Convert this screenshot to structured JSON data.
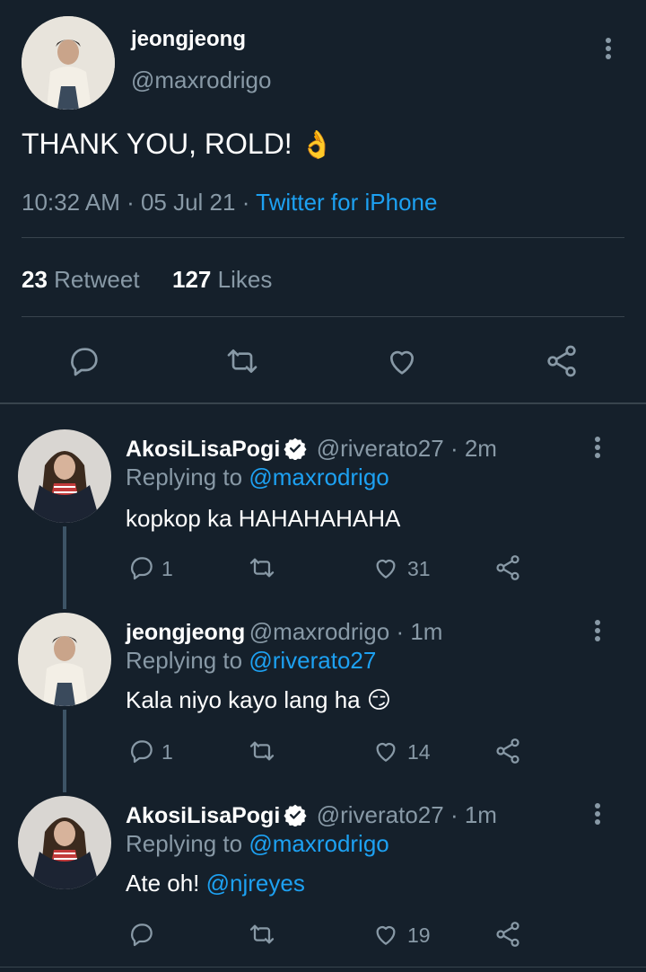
{
  "main_tweet": {
    "name": "jeongjeong",
    "handle": "@maxrodrigo",
    "text": "THANK YOU, ROLD!",
    "emoji": "👌",
    "time": "10:32 AM · 05 Jul 21 ·",
    "source": "Twitter for iPhone",
    "retweet_count": "23",
    "retweet_label": "Retweet",
    "likes_count": "127",
    "likes_label": "Likes"
  },
  "replies": [
    {
      "name": "AkosiLisaPogi",
      "handle": "@riverato27 · 2m",
      "replying_label": "Replying to",
      "replying_to": "@maxrodrigo",
      "text": "kopkop ka HAHAHAHAHA",
      "reply_count": "1",
      "like_count": "31"
    },
    {
      "name": "jeongjeong",
      "handle": "@maxrodrigo · 1m",
      "replying_label": "Replying to",
      "replying_to": "@riverato27",
      "text": "Kala niyo kayo lang ha",
      "emoji": "😏",
      "reply_count": "1",
      "like_count": "14"
    },
    {
      "name": "AkosiLisaPogi",
      "handle": "@riverato27 · 1m",
      "replying_label": "Replying to",
      "replying_to": "@maxrodrigo",
      "text": "Ate oh!",
      "mention": "@njreyes",
      "reply_count": "",
      "like_count": "19"
    }
  ],
  "colors": {
    "background": "#15202b",
    "muted": "#8899a6",
    "link": "#1da1f2",
    "divider": "#38444d"
  },
  "icons": [
    "more-vertical-icon",
    "reply-icon",
    "retweet-icon",
    "like-icon",
    "share-icon",
    "verified-badge-icon"
  ]
}
